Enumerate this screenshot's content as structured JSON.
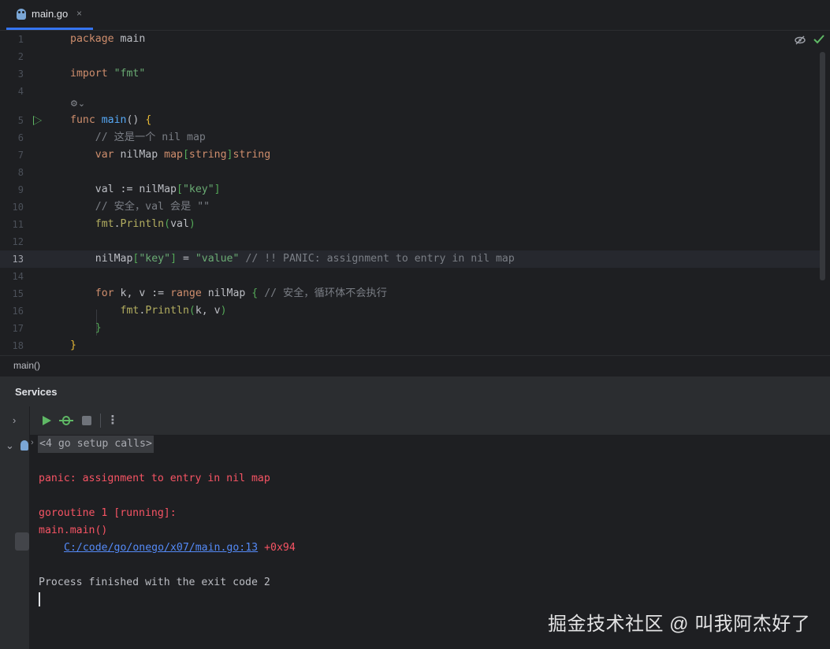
{
  "tab": {
    "icon": "go-file-icon",
    "label": "main.go",
    "close": "×"
  },
  "editor": {
    "inlay_hint": "⚙⌄",
    "line_numbers": [
      "1",
      "2",
      "3",
      "4",
      "5",
      "6",
      "7",
      "8",
      "9",
      "10",
      "11",
      "12",
      "13",
      "14",
      "15",
      "16",
      "17",
      "18"
    ],
    "current_line": 13,
    "lines": [
      "package main",
      "",
      "import \"fmt\"",
      "",
      "func main() {",
      "    // 这是一个 nil map",
      "    var nilMap map[string]string",
      "",
      "    val := nilMap[\"key\"]",
      "    // 安全，val 会是 \"\"",
      "    fmt.Println(val)",
      "",
      "    nilMap[\"key\"] = \"value\" // !! PANIC: assignment to entry in nil map",
      "",
      "    for k, v := range nilMap { // 安全，循环体不会执行",
      "        fmt.Println(k, v)",
      "    }",
      "}"
    ],
    "reader_mode_icon": "eye-slash-icon",
    "status_icon": "checkmark-icon"
  },
  "breadcrumb": {
    "label": "main()"
  },
  "services": {
    "title": "Services",
    "toolbar": [
      "run-icon",
      "debug-icon",
      "stop-icon",
      "more-icon"
    ],
    "console": {
      "setup": "<4 go setup calls>",
      "panic": "panic: assignment to entry in nil map",
      "goroutine": "goroutine 1 [running]:",
      "frame": "main.main()",
      "path_link": "C:/code/go/onego/x07/main.go:13",
      "offset": " +0x94",
      "finished": "Process finished with the exit code 2"
    }
  },
  "watermark": "掘金技术社区 @ 叫我阿杰好了",
  "colors": {
    "keyword": "#cf8e6d",
    "function": "#56a8f5",
    "string": "#6aab73",
    "comment": "#7a7e85",
    "error": "#f75464",
    "link": "#548af7",
    "accent": "#3574f0"
  }
}
